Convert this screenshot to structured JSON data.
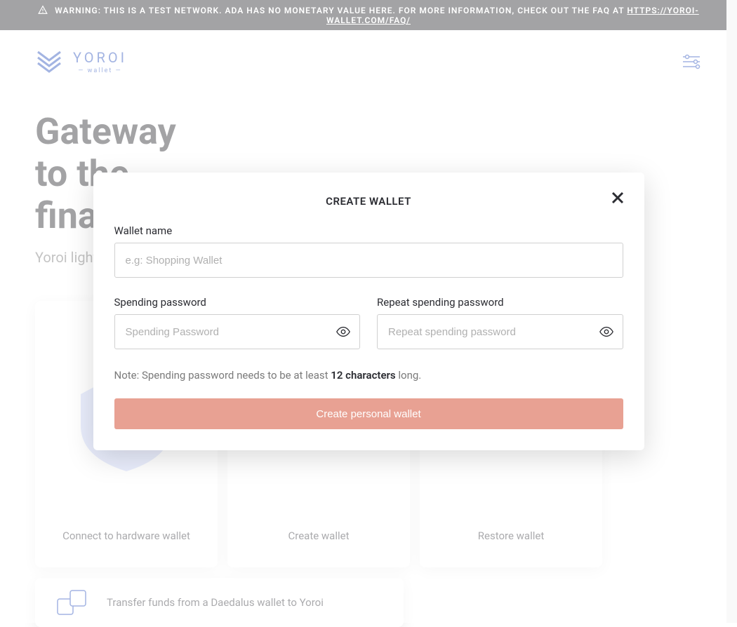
{
  "banner": {
    "warning_prefix": "WARNING: THIS IS A TEST NETWORK. ADA HAS NO MONETARY VALUE HERE. FOR MORE INFORMATION, CHECK OUT THE FAQ AT ",
    "faq_url_text": "HTTPS://YOROI-WALLET.COM/FAQ/"
  },
  "brand": {
    "name": "YOROI",
    "sub": "— wallet —"
  },
  "hero": {
    "line1": "Gateway",
    "line2": "to the",
    "line3": "financial world",
    "subtitle": "Yoroi light wallet for Cardano"
  },
  "cards": [
    {
      "label": "Connect to hardware wallet"
    },
    {
      "label": "Create wallet"
    },
    {
      "label": "Restore wallet"
    }
  ],
  "transfer": {
    "label": "Transfer funds from a Daedalus wallet to Yoroi"
  },
  "modal": {
    "title": "CREATE WALLET",
    "wallet_name_label": "Wallet name",
    "wallet_name_placeholder": "e.g: Shopping Wallet",
    "spending_label": "Spending password",
    "spending_placeholder": "Spending Password",
    "repeat_label": "Repeat spending password",
    "repeat_placeholder": "Repeat spending password",
    "note_prefix": "Note: Spending password needs to be at least ",
    "note_bold": "12 characters",
    "note_suffix": " long.",
    "create_button": "Create personal wallet"
  },
  "colors": {
    "accent_salmon": "#e8a193",
    "brand_blue": "#1a44b7"
  }
}
